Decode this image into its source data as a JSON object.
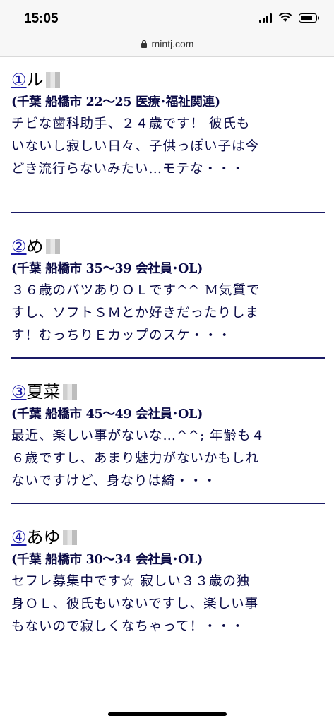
{
  "status": {
    "time": "15:05"
  },
  "browser": {
    "url": "mintj.com"
  },
  "entries": [
    {
      "number": "①",
      "name": "ル",
      "meta": "(千葉 船橋市 22〜25 医療･福祉関連)",
      "lines": [
        "チビな歯科助手、２４歳です！ 彼氏も",
        "いないし寂しい日々、子供っぽい子は今",
        "どき流行らないみたい…モテな・・・"
      ]
    },
    {
      "number": "②",
      "name": "め",
      "meta": "(千葉 船橋市 35〜39 会社員･OL)",
      "lines": [
        "３６歳のバツありＯＬです^^ M気質で",
        "すし、ソフトＳＭとか好きだったりしま",
        "す！むっちりＥカップのスケ・・・"
      ]
    },
    {
      "number": "③",
      "name": "夏菜",
      "meta": "(千葉 船橋市 45〜49 会社員･OL)",
      "lines": [
        "最近、楽しい事がないな…^^; 年齢も４",
        "６歳ですし、あまり魅力がないかもしれ",
        "ないですけど、身なりは綺・・・"
      ]
    },
    {
      "number": "④",
      "name": "あゆ",
      "meta": "(千葉 船橋市 30〜34 会社員･OL)",
      "lines": [
        "セフレ募集中です☆ 寂しい３３歳の独",
        "身ＯＬ、彼氏もいないですし、楽しい事",
        "もないので寂しくなちゃって！・・・"
      ]
    }
  ]
}
